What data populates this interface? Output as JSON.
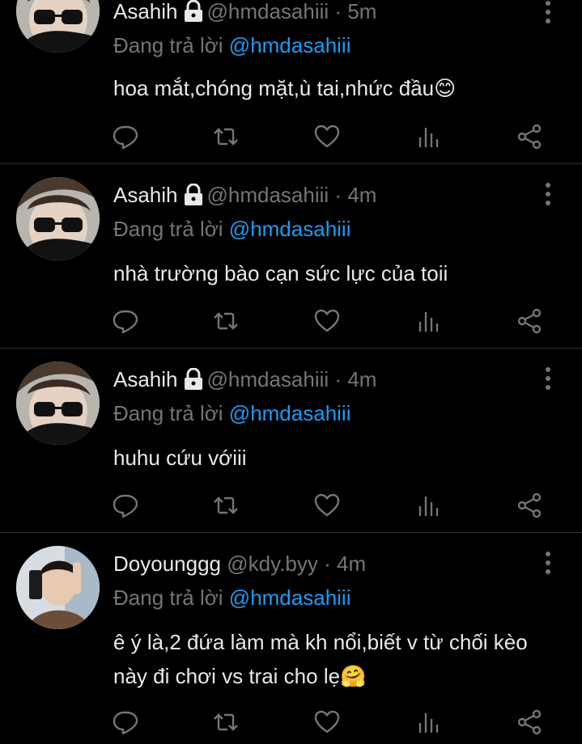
{
  "colors": {
    "background": "#000000",
    "text_primary": "#e7e9ea",
    "text_secondary": "#71767b",
    "accent": "#1d9bf0",
    "divider": "#2f3336"
  },
  "tweets": [
    {
      "display_name": "Asahih",
      "locked": true,
      "handle": "@hmdasahiii",
      "time": "5m",
      "replying_prefix": "Đang trả lời",
      "replying_to": "@hmdasahiii",
      "text_lines": [
        "hoa mắt,chóng mặt,ù tai,nhức đầu😊"
      ],
      "avatar": "person-with-glasses-avatar"
    },
    {
      "display_name": "Asahih",
      "locked": true,
      "handle": "@hmdasahiii",
      "time": "4m",
      "replying_prefix": "Đang trả lời",
      "replying_to": "@hmdasahiii",
      "text_lines": [
        "nhà trường bào cạn sức lực của toii"
      ],
      "avatar": "person-with-glasses-avatar"
    },
    {
      "display_name": "Asahih",
      "locked": true,
      "handle": "@hmdasahiii",
      "time": "4m",
      "replying_prefix": "Đang trả lời",
      "replying_to": "@hmdasahiii",
      "text_lines": [
        "huhu cứu vớiii"
      ],
      "avatar": "person-with-glasses-avatar"
    },
    {
      "display_name": "Doyounggg",
      "locked": false,
      "handle": "@kdy.byy",
      "time": "4m",
      "replying_prefix": "Đang trả lời",
      "replying_to": "@hmdasahiii",
      "text_lines": [
        "ê ý là,2 đứa làm mà kh nổi,biết v từ chối kèo",
        "này đi chơi vs trai cho lẹ🤗"
      ],
      "avatar": "person-selfie-avatar"
    }
  ],
  "separator": "·",
  "action_icons": [
    "reply-icon",
    "retweet-icon",
    "like-icon",
    "views-icon",
    "share-icon"
  ]
}
